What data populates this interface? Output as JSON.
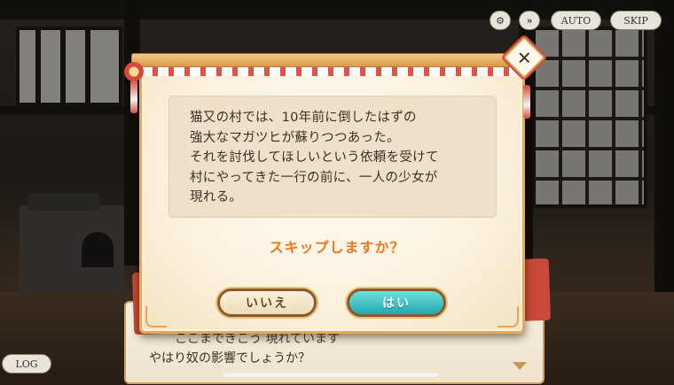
{
  "controls": {
    "gear_icon": "gear-icon",
    "fast_forward_label": "»",
    "auto_label": "AUTO",
    "skip_label": "SKIP",
    "log_label": "LOG"
  },
  "dialog": {
    "close_glyph": "✕",
    "synopsis_lines": [
      "猫又の村では、10年前に倒したはずの",
      "強大なマガツヒが蘇りつつあった。",
      "それを討伐してほしいという依頼を受けて",
      "村にやってきた一行の前に、一人の少女が",
      "現れる。"
    ],
    "question": "スキップしますか？",
    "no_label": "いいえ",
    "yes_label": "はい"
  },
  "message_box": {
    "partial_line": "ここまできこう 現れています",
    "line": "やはり奴の影響でしょうか？"
  },
  "colors": {
    "accent_orange": "#f0781e",
    "yes_button": "#22a8b0",
    "frame": "#e8a65a"
  }
}
